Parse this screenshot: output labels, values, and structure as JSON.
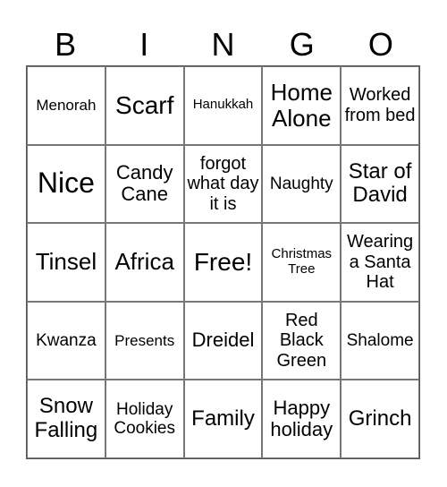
{
  "header": [
    "B",
    "I",
    "N",
    "G",
    "O"
  ],
  "cells": [
    [
      "Menorah",
      "Scarf",
      "Hanukkah",
      "Home Alone",
      "Worked from bed"
    ],
    [
      "Nice",
      "Candy Cane",
      "forgot what day it is",
      "Naughty",
      "Star of David"
    ],
    [
      "Tinsel",
      "Africa",
      "Free!",
      "Christmas Tree",
      "Wearing a Santa Hat"
    ],
    [
      "Kwanza",
      "Presents",
      "Dreidel",
      "Red Black Green",
      "Shalome"
    ],
    [
      "Snow Falling",
      "Holiday Cookies",
      "Family",
      "Happy holiday",
      "Grinch"
    ]
  ]
}
